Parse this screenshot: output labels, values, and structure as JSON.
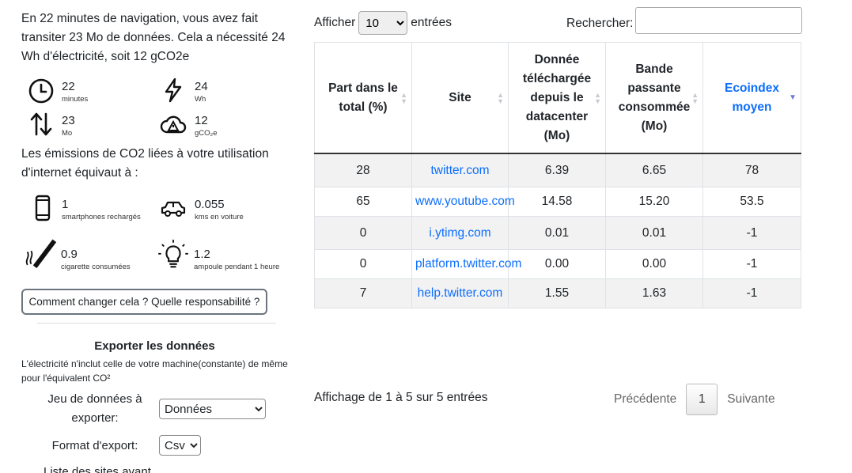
{
  "intro": "En 22 minutes de navigation, vous avez fait transiter 23 Mo de données. Cela a nécessité 24 Wh d'électricité, soit 12 gCO2e",
  "stats": [
    {
      "icon": "timer-icon",
      "value": "22",
      "unit": "minutes"
    },
    {
      "icon": "lightning-icon",
      "value": "24",
      "unit": "Wh"
    },
    {
      "icon": "transfer-arrows-icon",
      "value": "23",
      "unit": "Mo"
    },
    {
      "icon": "cloud-warning-icon",
      "value": "12",
      "unit": "gCO₂e"
    }
  ],
  "emissions_text": "Les émissions de CO2 liées à votre utilisation d'internet équivaut à :",
  "equivalents": [
    {
      "icon": "smartphone-icon",
      "value": "1",
      "unit": "smartphones rechargés"
    },
    {
      "icon": "car-icon",
      "value": "0.055",
      "unit": "kms en voiture"
    },
    {
      "icon": "cigarette-icon",
      "value": "0.9",
      "unit": "cigarette consumées"
    },
    {
      "icon": "lightbulb-icon",
      "value": "1.2",
      "unit": "ampoule pendant 1 heure"
    }
  ],
  "change_button": "Comment changer cela ? Quelle responsabilité ?",
  "export": {
    "title": "Exporter les données",
    "note": "L'électricité n'inclut celle de votre machine(constante) de même pour l'équivalent CO²",
    "dataset_label": "Jeu de données à exporter:",
    "dataset_value": "Données",
    "format_label": "Format d'export:",
    "format_value": "Csv"
  },
  "cut_text": "Liste des sites ayant ...",
  "table_controls": {
    "show_label": "Afficher",
    "show_value": "10",
    "entries_label": "entrées",
    "search_label": "Rechercher:"
  },
  "table": {
    "headers": [
      "Part dans le total (%)",
      "Site",
      "Donnée téléchargée depuis le datacenter (Mo)",
      "Bande passante consommée (Mo)",
      "Ecoindex moyen"
    ],
    "rows": [
      [
        "28",
        "twitter.com",
        "6.39",
        "6.65",
        "78"
      ],
      [
        "65",
        "www.youtube.com",
        "14.58",
        "15.20",
        "53.5"
      ],
      [
        "0",
        "i.ytimg.com",
        "0.01",
        "0.01",
        "-1"
      ],
      [
        "0",
        "platform.twitter.com",
        "0.00",
        "0.00",
        "-1"
      ],
      [
        "7",
        "help.twitter.com",
        "1.55",
        "1.63",
        "-1"
      ]
    ]
  },
  "table_info": "Affichage de 1 à 5 sur 5 entrées",
  "pager": {
    "prev": "Précédente",
    "page": "1",
    "next": "Suivante"
  }
}
